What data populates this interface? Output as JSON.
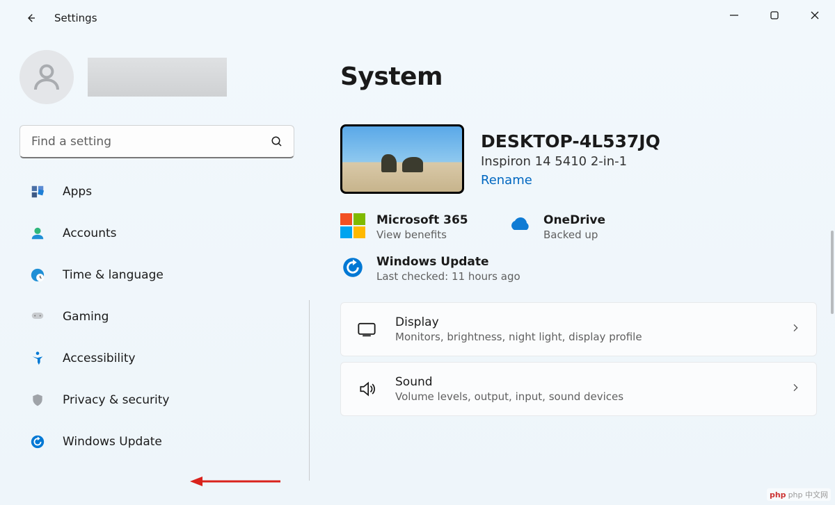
{
  "app_title": "Settings",
  "search": {
    "placeholder": "Find a setting"
  },
  "nav": {
    "apps": "Apps",
    "accounts": "Accounts",
    "time_language": "Time & language",
    "gaming": "Gaming",
    "accessibility": "Accessibility",
    "privacy": "Privacy & security",
    "windows_update": "Windows Update"
  },
  "page_title": "System",
  "device": {
    "name": "DESKTOP-4L537JQ",
    "model": "Inspiron 14 5410 2-in-1",
    "rename": "Rename"
  },
  "status": {
    "m365": {
      "title": "Microsoft 365",
      "sub": "View benefits"
    },
    "onedrive": {
      "title": "OneDrive",
      "sub": "Backed up"
    },
    "update": {
      "title": "Windows Update",
      "sub": "Last checked: 11 hours ago"
    }
  },
  "cards": {
    "display": {
      "title": "Display",
      "sub": "Monitors, brightness, night light, display profile"
    },
    "sound": {
      "title": "Sound",
      "sub": "Volume levels, output, input, sound devices"
    }
  },
  "watermark": "php 中文网"
}
